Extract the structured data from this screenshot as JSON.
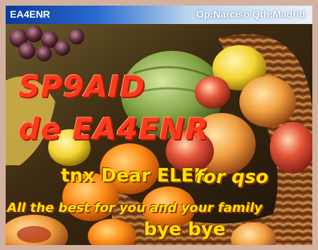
{
  "header": {
    "callsign": "EA4ENR",
    "info": "Op:Narciso  Qth:Madrid"
  },
  "card": {
    "to_call": "SP9AID",
    "from_call": "de EA4ENR",
    "thanks": "tnx  Dear ELEK",
    "for_qso": "for qso",
    "wishes": "All the best for you and your family",
    "closing": "bye bye"
  },
  "colors": {
    "frame": "#d2b1a0",
    "title_blue": "#0a3a9a",
    "red_text": "#ff3a1a",
    "yellow_text": "#ffe100"
  }
}
